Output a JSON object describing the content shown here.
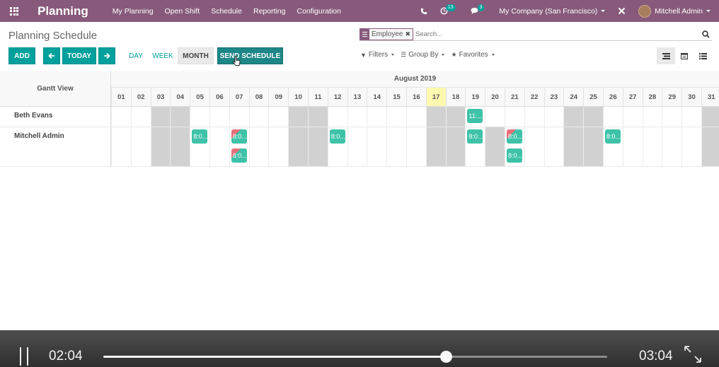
{
  "navbar": {
    "brand": "Planning",
    "menu": [
      "My Planning",
      "Open Shift",
      "Schedule",
      "Reporting",
      "Configuration"
    ],
    "phone_icon": "phone-icon",
    "activity_count": "13",
    "messages_count": "3",
    "company": "My Company (San Francisco)",
    "user": "Mitchell Admin"
  },
  "control": {
    "title": "Planning Schedule",
    "facet_label": "Employee",
    "search_placeholder": "Search...",
    "add": "ADD",
    "today": "TODAY",
    "day": "DAY",
    "week": "WEEK",
    "month": "MONTH",
    "send_schedule": "SEND SCHEDULE",
    "filters": "Filters",
    "group_by": "Group By",
    "favorites": "Favorites"
  },
  "gantt": {
    "header_title": "Gantt View",
    "month": "August 2019",
    "days": [
      "01",
      "02",
      "03",
      "04",
      "05",
      "06",
      "07",
      "08",
      "09",
      "10",
      "11",
      "12",
      "13",
      "14",
      "15",
      "16",
      "17",
      "18",
      "19",
      "20",
      "21",
      "22",
      "23",
      "24",
      "25",
      "26",
      "27",
      "28",
      "29",
      "30",
      "31"
    ],
    "weekend_days": [
      "03",
      "04",
      "10",
      "11",
      "17",
      "18",
      "24",
      "25",
      "31"
    ],
    "today": "17",
    "rows": [
      {
        "name": "Beth Evans",
        "weekend_overrides_off": [],
        "extra_grey": [],
        "pills": [
          {
            "day": "19",
            "lane": 0,
            "label": "11:...",
            "conflict": false
          }
        ]
      },
      {
        "name": "Mitchell Admin",
        "weekend_overrides_off": [],
        "extra_grey": [
          "20"
        ],
        "pills": [
          {
            "day": "05",
            "lane": 0,
            "label": "8:0...",
            "conflict": false
          },
          {
            "day": "07",
            "lane": 0,
            "label": "8:0...",
            "conflict": true
          },
          {
            "day": "07",
            "lane": 1,
            "label": "8:0...",
            "conflict": true
          },
          {
            "day": "12",
            "lane": 0,
            "label": "8:0...",
            "conflict": false
          },
          {
            "day": "19",
            "lane": 0,
            "label": "8:0...",
            "conflict": false
          },
          {
            "day": "21",
            "lane": 0,
            "label": "8:0...",
            "conflict": true
          },
          {
            "day": "21",
            "lane": 1,
            "label": "8:0...",
            "conflict": false
          },
          {
            "day": "26",
            "lane": 0,
            "label": "8:0...",
            "conflict": false
          }
        ]
      }
    ]
  },
  "video": {
    "current_time": "02:04",
    "total_time": "03:04",
    "progress": 0.68
  },
  "colors": {
    "brand": "#875a7b",
    "accent": "#00a09d",
    "pill": "#3ec2a8",
    "conflict": "#e46f78",
    "weekend": "#d1d1d1",
    "today": "#fcf8b0"
  }
}
